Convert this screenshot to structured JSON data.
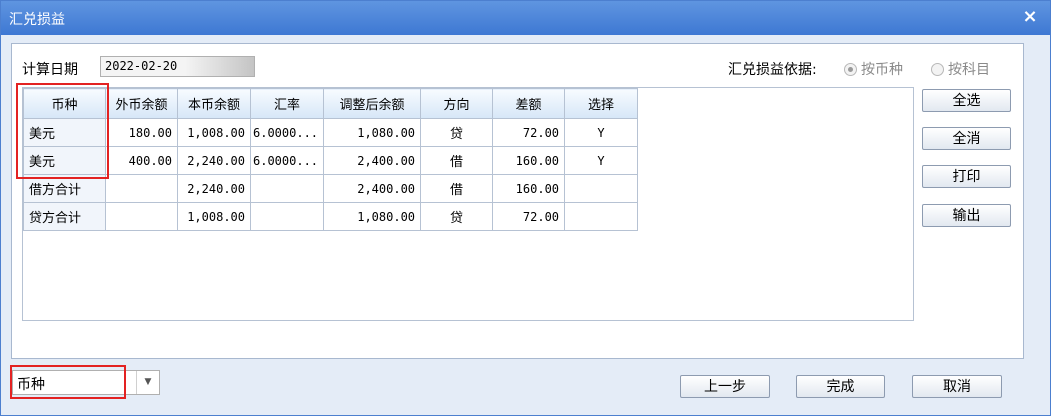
{
  "window": {
    "title": "汇兑损益",
    "close_icon": "×"
  },
  "calc_date": {
    "label": "计算日期",
    "value": "2022-02-20"
  },
  "basis": {
    "label": "汇兑损益依据:",
    "options": [
      {
        "label": "按币种",
        "selected": true
      },
      {
        "label": "按科目",
        "selected": false
      }
    ]
  },
  "table": {
    "columns": [
      "币种",
      "外币余额",
      "本币余额",
      "汇率",
      "调整后余额",
      "方向",
      "差额",
      "选择"
    ],
    "rows": [
      [
        "美元",
        "180.00",
        "1,008.00",
        "6.0000...",
        "1,080.00",
        "贷",
        "72.00",
        "Y"
      ],
      [
        "美元",
        "400.00",
        "2,240.00",
        "6.0000...",
        "2,400.00",
        "借",
        "160.00",
        "Y"
      ],
      [
        "借方合计",
        "",
        "2,240.00",
        "",
        "2,400.00",
        "借",
        "160.00",
        ""
      ],
      [
        "贷方合计",
        "",
        "1,008.00",
        "",
        "1,080.00",
        "贷",
        "72.00",
        ""
      ]
    ]
  },
  "side_buttons": {
    "select_all": "全选",
    "deselect_all": "全消",
    "print": "打印",
    "export": "输出"
  },
  "sort_select": {
    "value": "币种"
  },
  "footer_buttons": {
    "prev": "上一步",
    "finish": "完成",
    "cancel": "取消"
  },
  "colors": {
    "titlebar": "#3e78d3",
    "highlight_box": "#e32222"
  }
}
